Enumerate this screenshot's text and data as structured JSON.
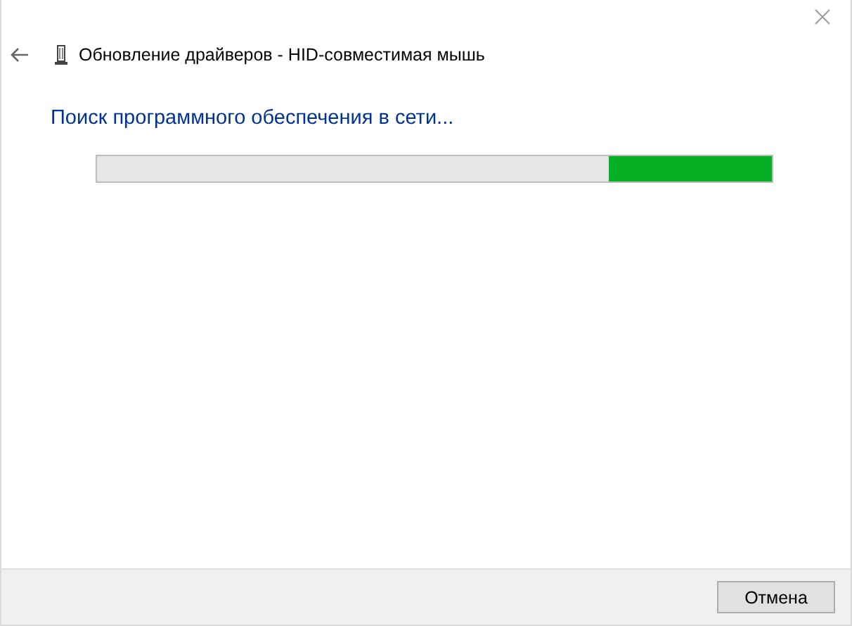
{
  "window": {
    "title": "Обновление драйверов - HID-совместимая мышь"
  },
  "heading": "Поиск программного обеспечения в сети...",
  "progress": {
    "indeterminate": true
  },
  "buttons": [
    {
      "label": "Отмена"
    }
  ]
}
